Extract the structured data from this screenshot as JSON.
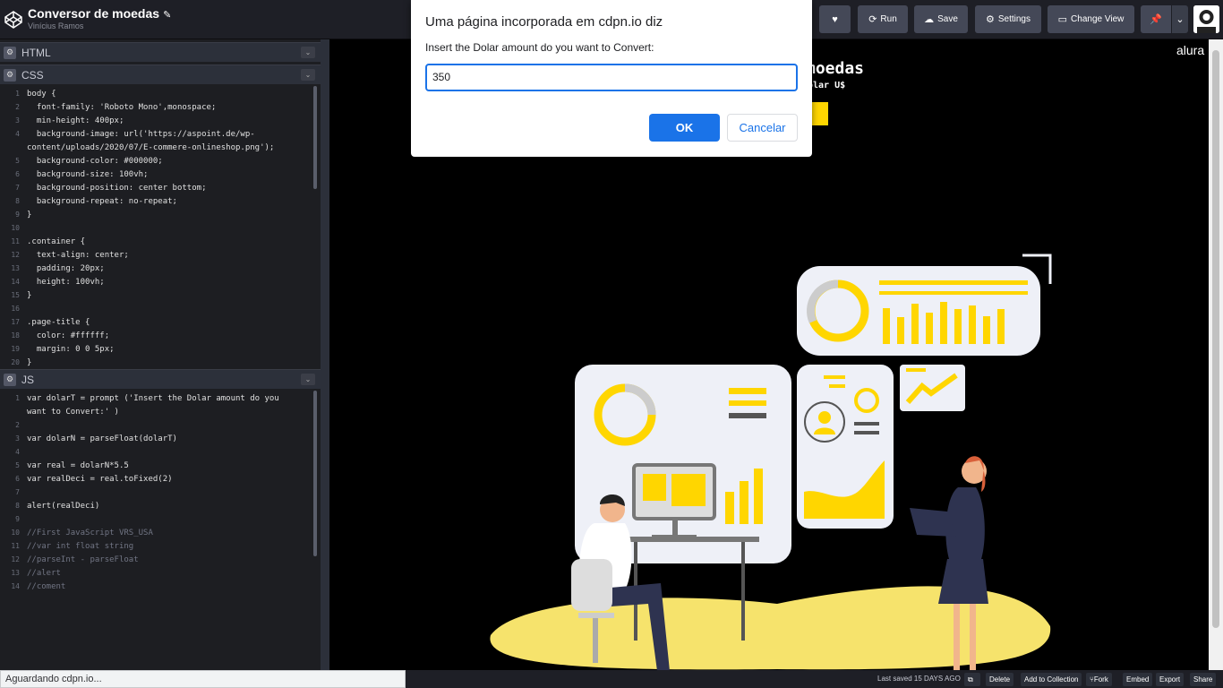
{
  "header": {
    "pen_title": "Conversor de moedas",
    "pen_title_edit_icon": "pencil-icon",
    "author": "Vinícius Ramos",
    "buttons": {
      "like_icon": "heart-icon",
      "run": "Run",
      "save": "Save",
      "settings": "Settings",
      "change_view": "Change View",
      "pin_icon": "pin-icon",
      "menu_icon": "chevron-down-icon"
    }
  },
  "panels": {
    "html": {
      "title": "HTML"
    },
    "css": {
      "title": "CSS",
      "lines": [
        {
          "n": "1",
          "t": "body {"
        },
        {
          "n": "2",
          "t": "  font-family: 'Roboto Mono',monospace;"
        },
        {
          "n": "3",
          "t": "  min-height: 400px;"
        },
        {
          "n": "4",
          "t": "  background-image: url('https://aspoint.de/wp-"
        },
        {
          "n": "",
          "t": "content/uploads/2020/07/E-commere-onlineshop.png');"
        },
        {
          "n": "5",
          "t": "  background-color: #000000;"
        },
        {
          "n": "6",
          "t": "  background-size: 100vh;"
        },
        {
          "n": "7",
          "t": "  background-position: center bottom;"
        },
        {
          "n": "8",
          "t": "  background-repeat: no-repeat;"
        },
        {
          "n": "9",
          "t": "}"
        },
        {
          "n": "10",
          "t": ""
        },
        {
          "n": "11",
          "t": ".container {"
        },
        {
          "n": "12",
          "t": "  text-align: center;"
        },
        {
          "n": "13",
          "t": "  padding: 20px;"
        },
        {
          "n": "14",
          "t": "  height: 100vh;"
        },
        {
          "n": "15",
          "t": "}"
        },
        {
          "n": "16",
          "t": ""
        },
        {
          "n": "17",
          "t": ".page-title {"
        },
        {
          "n": "18",
          "t": "  color: #ffffff;"
        },
        {
          "n": "19",
          "t": "  margin: 0 0 5px;"
        },
        {
          "n": "20",
          "t": "}"
        }
      ]
    },
    "js": {
      "title": "JS",
      "lines": [
        {
          "n": "1",
          "t": "var dolarT = prompt ('Insert the Dolar amount do you"
        },
        {
          "n": "",
          "t": "want to Convert:' )"
        },
        {
          "n": "2",
          "t": ""
        },
        {
          "n": "3",
          "t": "var dolarN = parseFloat(dolarT)"
        },
        {
          "n": "4",
          "t": ""
        },
        {
          "n": "5",
          "t": "var real = dolarN*5.5"
        },
        {
          "n": "6",
          "t": "var realDeci = real.toFixed(2)"
        },
        {
          "n": "7",
          "t": ""
        },
        {
          "n": "8",
          "t": "alert(realDeci)"
        },
        {
          "n": "9",
          "t": ""
        },
        {
          "n": "10",
          "t": "//First JavaScript VRS_USA"
        },
        {
          "n": "11",
          "t": "//var int float string"
        },
        {
          "n": "12",
          "t": "//parseInt - parseFloat"
        },
        {
          "n": "13",
          "t": "//alert"
        },
        {
          "n": "14",
          "t": "//coment"
        }
      ]
    }
  },
  "preview": {
    "title_fragment": "moedas",
    "subtitle_fragment": "olar U$",
    "brand": "alura"
  },
  "dialog": {
    "title": "Uma página incorporada em cdpn.io diz",
    "message": "Insert the Dolar amount do you want to Convert:",
    "input_value": "350",
    "ok": "OK",
    "cancel": "Cancelar"
  },
  "footer": {
    "status": "Aguardando cdpn.io...",
    "last_saved": "Last saved 15 DAYS AGO",
    "items": [
      "Delete",
      "Add to Collection",
      "Fork",
      "Embed",
      "Export",
      "Share"
    ]
  },
  "colors": {
    "accent_blue": "#1a73e8",
    "codepen_dark": "#1e1f26",
    "illustration_yellow": "#ffd600"
  }
}
